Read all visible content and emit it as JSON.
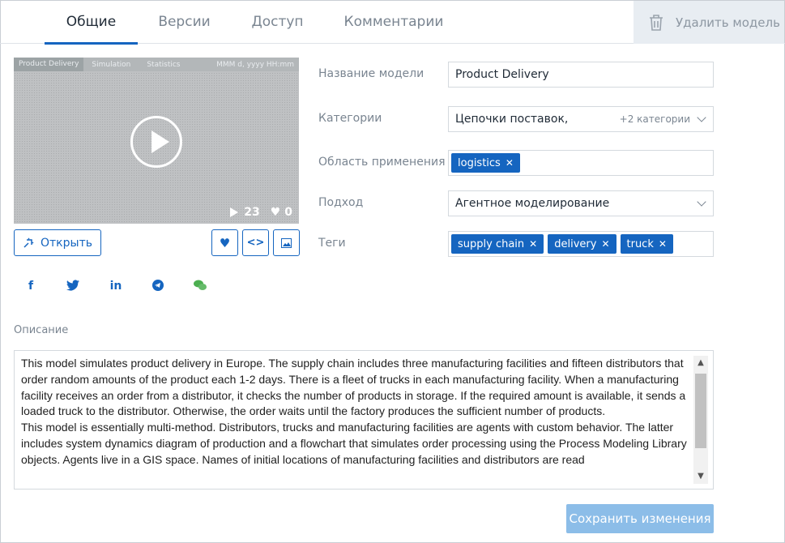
{
  "tabs": [
    {
      "label": "Общие",
      "active": true
    },
    {
      "label": "Версии",
      "active": false
    },
    {
      "label": "Доступ",
      "active": false
    },
    {
      "label": "Комментарии",
      "active": false
    }
  ],
  "delete_button": {
    "label": "Удалить модель",
    "icon": "trash-icon"
  },
  "video": {
    "overlay_title": "Product Delivery",
    "overlay_menu": [
      "Simulation",
      "Statistics"
    ],
    "overlay_right": "MMM d, yyyy   HH:mm",
    "watch_count": "23",
    "like_count": "0"
  },
  "actions": {
    "open_label": "Открыть",
    "like_icon": "heart-icon",
    "embed_icon": "code-icon",
    "image_icon": "image-icon"
  },
  "social": {
    "facebook": "f",
    "twitter": "twitter-icon",
    "linkedin": "in",
    "telegram": "telegram-icon",
    "wechat": "wechat-icon"
  },
  "form": {
    "name": {
      "label": "Название модели",
      "value": "Product Delivery"
    },
    "categories": {
      "label": "Категории",
      "value": "Цепочки поставок,",
      "extra": "+2 категории"
    },
    "application": {
      "label": "Область применения",
      "chips": [
        "logistics"
      ]
    },
    "approach": {
      "label": "Подход",
      "value": "Агентное моделирование"
    },
    "tags": {
      "label": "Теги",
      "chips": [
        "supply chain",
        "delivery",
        "truck"
      ]
    }
  },
  "description": {
    "label": "Описание",
    "text": "This model simulates product delivery in Europe. The supply chain includes three manufacturing facilities and fifteen distributors that order random amounts of the product each 1-2 days. There is a fleet of trucks in each manufacturing facility. When a manufacturing facility receives an order from a distributor, it checks the number of products in storage. If the required amount is available, it sends a loaded truck to the distributor. Otherwise, the order waits until the factory produces the sufficient number of products.",
    "text2": "This model is essentially multi-method. Distributors, trucks and manufacturing facilities are agents with custom behavior. The latter includes system dynamics diagram of production and a flowchart that simulates order processing using the Process Modeling Library objects. Agents live in a GIS space. Names of initial locations of manufacturing facilities and distributors are read"
  },
  "save_button": {
    "label": "Сохранить изменения"
  },
  "colors": {
    "accent": "#1565c0",
    "save_disabled": "#8cbde8",
    "label": "#7a8591"
  }
}
